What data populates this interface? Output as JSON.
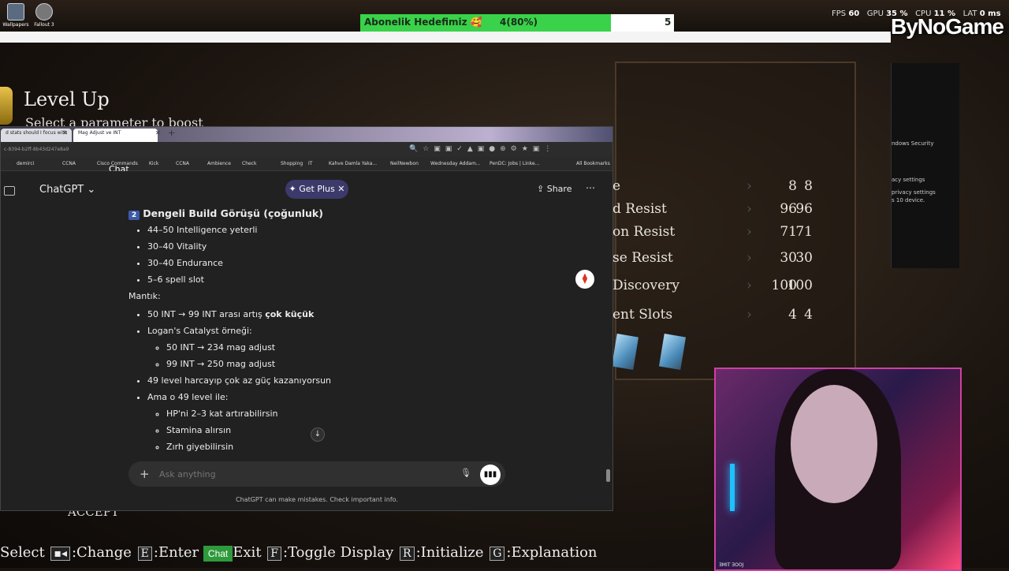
{
  "desktop": {
    "icons": [
      {
        "label": "Wallpapers"
      },
      {
        "label": "Fallout 3"
      }
    ]
  },
  "stream_overlay": {
    "subscriber_goal_label": "Abonelik Hedefimiz 🥰",
    "subscriber_goal_value": "4(80%)",
    "subscriber_goal_progress": 0.8,
    "subscriber_goal_target": "5",
    "brand": "ByNoGame",
    "perf": {
      "fps_label": "FPS",
      "fps_value": "60",
      "gpu_label": "GPU",
      "gpu_value": "35 %",
      "cpu_label": "CPU",
      "cpu_value": "11 %",
      "lat_label": "LAT",
      "lat_value": "0 ms"
    },
    "webcam_caption": "ƎMIT ƎOOJ",
    "chat_badge": "Chat"
  },
  "game": {
    "title": "Level Up",
    "subtitle": "Select a parameter to boost",
    "stats": [
      {
        "name": "e",
        "current": "8",
        "next": "8"
      },
      {
        "name": "d Resist",
        "current": "96",
        "next": "96"
      },
      {
        "name": "on Resist",
        "current": "71",
        "next": "71"
      },
      {
        "name": "se Resist",
        "current": "30",
        "next": "30"
      },
      {
        "name": "Discovery",
        "current": "100",
        "next": "100"
      },
      {
        "name": "ent Slots",
        "current": "4",
        "next": "4"
      }
    ],
    "accept_label": "ACCEPT",
    "controls": {
      "select_label": "Select",
      "change_label": ":Change",
      "enter_key": "E",
      "enter_label": ":Enter",
      "exit_label": "Exit",
      "toggle_key": "F",
      "toggle_label": ":Toggle Display",
      "init_key": "R",
      "init_label": ":Initialize",
      "expl_key": "G",
      "expl_label": ":Explanation"
    }
  },
  "windows_panel": {
    "items": [
      "ndows Security",
      "acy settings",
      "privacy settings",
      "s 10 device."
    ]
  },
  "browser": {
    "tabs": [
      {
        "label": "d stats should I focus with"
      },
      {
        "label": "Mag Adjust ve INT"
      }
    ],
    "address": "c-8394-b2ff-8b43d247e8a9",
    "bookmarks": [
      "demirci",
      "CCNA",
      "Cisco Commands",
      "Kick",
      "CCNA",
      "Ambience",
      "Check",
      "Shopping",
      "IT",
      "Kahve Damla Yaka...",
      "NeilNewbon",
      "Wednesday Addam...",
      "PenDC: Jobs | Linke...",
      "All Bookmarks"
    ],
    "chat_overlay_label": "Chat"
  },
  "chatgpt": {
    "title": "ChatGPT",
    "get_plus": "Get Plus",
    "share": "Share",
    "section_number": "2",
    "section_title": "Dengeli Build Görüşü (çoğunluk)",
    "build_items": [
      "44–50 Intelligence yeterli",
      "30–40 Vitality",
      "30–40 Endurance",
      "5–6 spell slot"
    ],
    "logic_label": "Mantık:",
    "logic_item_1_pre": "50 INT → 99 INT arası artış ",
    "logic_item_1_bold": "çok küçük",
    "logic_item_2": "Logan's Catalyst örneği:",
    "logic_sub_1": "50 INT → 234 mag adjust",
    "logic_sub_2": "99 INT → 250 mag adjust",
    "logic_item_3": "49 level harcayıp çok az güç kazanıyorsun",
    "logic_item_4": "Ama o 49 level ile:",
    "benefit_1": "HP'ni 2–3 kat artırabilirsin",
    "benefit_2": "Stamina alırsın",
    "benefit_3": "Zırh giyebilirsin",
    "input_placeholder": "Ask anything",
    "disclaimer": "ChatGPT can make mistakes. Check important info."
  }
}
